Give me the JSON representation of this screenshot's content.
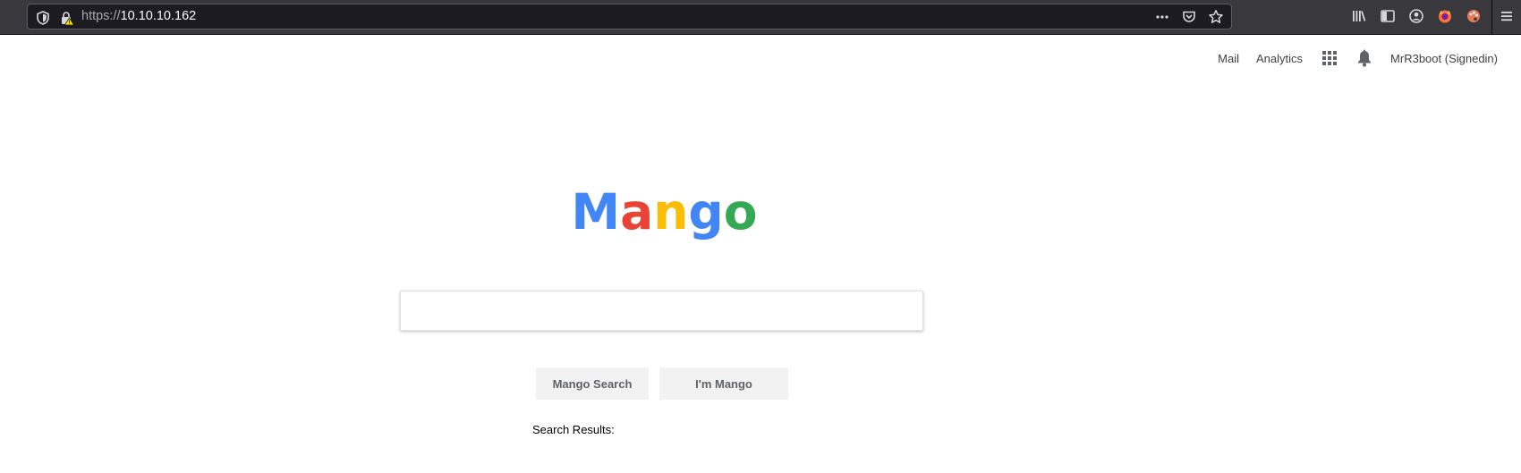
{
  "browser": {
    "url_scheme": "https://",
    "url_host": "10.10.10.162"
  },
  "nav": {
    "mail": "Mail",
    "analytics": "Analytics",
    "user": "MrR3boot (Signedin)"
  },
  "logo": {
    "letters": [
      "M",
      "a",
      "n",
      "g",
      "o"
    ],
    "colors": [
      "#4285f4",
      "#ea4335",
      "#fbbc05",
      "#4285f4",
      "#34a853"
    ]
  },
  "search": {
    "value": "",
    "search_button": "Mango Search",
    "lucky_button": "I'm Mango",
    "results_label": "Search Results:"
  }
}
